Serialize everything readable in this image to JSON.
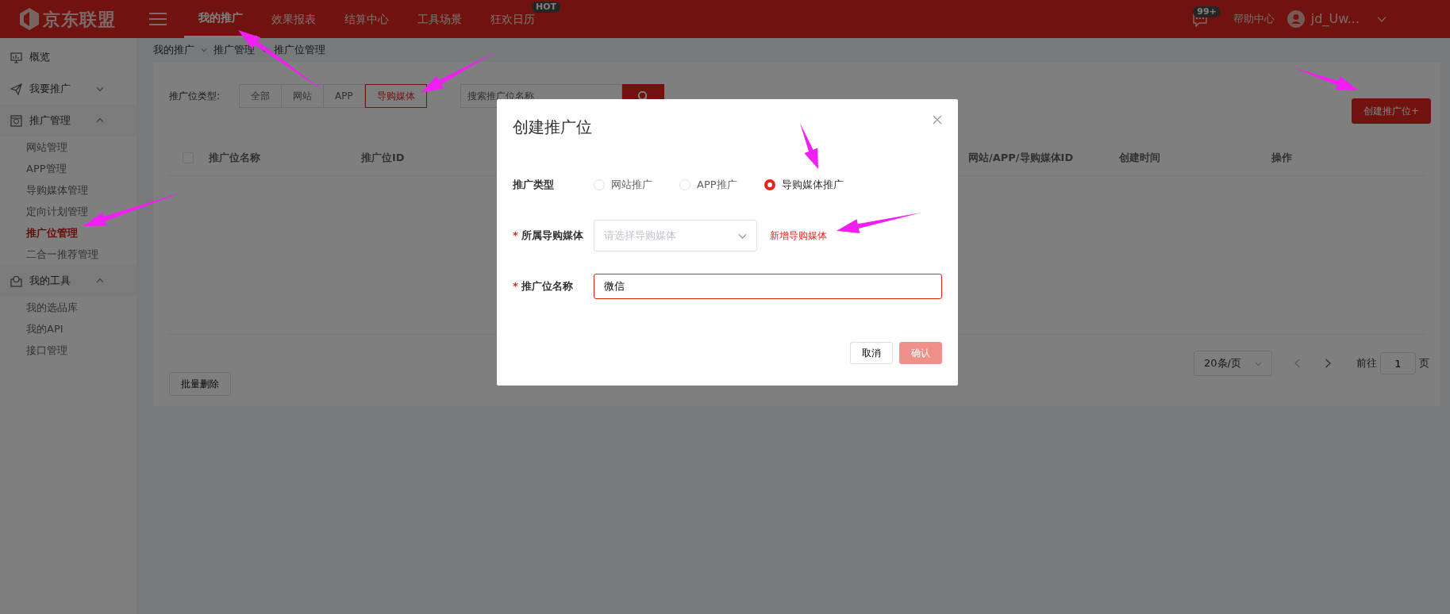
{
  "header": {
    "logo": "京东联盟",
    "nav": [
      {
        "label": "我的推广",
        "selected": true
      },
      {
        "label": "效果报表",
        "selected": false
      },
      {
        "label": "结算中心",
        "selected": false
      },
      {
        "label": "工具场景",
        "selected": false
      },
      {
        "label": "狂欢日历",
        "selected": false,
        "badge": "HOT"
      }
    ],
    "message_badge": "99+",
    "help": "帮助中心",
    "user": "jd_Uw..."
  },
  "sidebar": {
    "items": [
      {
        "label": "概览"
      },
      {
        "label": "我要推广",
        "expanded": false
      },
      {
        "label": "推广管理",
        "expanded": true,
        "children": [
          {
            "label": "网站管理",
            "selected": false
          },
          {
            "label": "APP管理",
            "selected": false
          },
          {
            "label": "导购媒体管理",
            "selected": false
          },
          {
            "label": "定向计划管理",
            "selected": false
          },
          {
            "label": "推广位管理",
            "selected": true
          },
          {
            "label": "二合一推荐管理",
            "selected": false
          }
        ]
      },
      {
        "label": "我的工具",
        "expanded": true,
        "children": [
          {
            "label": "我的选品库",
            "selected": false
          },
          {
            "label": "我的API",
            "selected": false
          },
          {
            "label": "接口管理",
            "selected": false
          }
        ]
      }
    ]
  },
  "breadcrumb": [
    "我的推广",
    "推广管理",
    "推广位管理"
  ],
  "filter": {
    "label": "推广位类型:",
    "options": [
      {
        "label": "全部",
        "selected": false
      },
      {
        "label": "网站",
        "selected": false
      },
      {
        "label": "APP",
        "selected": false
      },
      {
        "label": "导购媒体",
        "selected": true
      }
    ],
    "search": {
      "placeholder": "搜索推广位名称"
    }
  },
  "create_button": "创建推广位+",
  "table": {
    "select_all_checked": false,
    "columns": [
      "推广位名称",
      "推广位ID",
      "网站/APP/导购媒体ID",
      "创建时间",
      "操作"
    ]
  },
  "pagination": {
    "page_size": "20条/页",
    "goto_label": "前往",
    "page": "1",
    "page_suffix": "页"
  },
  "bulk_delete": "批量删除",
  "dialog": {
    "title": "创建推广位",
    "fields": [
      {
        "kind": "radio",
        "label": "推广类型",
        "options": [
          {
            "label": "网站推广",
            "selected": false
          },
          {
            "label": "APP推广",
            "selected": false
          },
          {
            "label": "导购媒体推广",
            "selected": true
          }
        ]
      },
      {
        "kind": "select",
        "label": "所属导购媒体",
        "required_mark": "*",
        "placeholder": "请选择导购媒体",
        "link": "新增导购媒体"
      },
      {
        "kind": "input",
        "label": "推广位名称",
        "required_mark": "*",
        "value": "微信",
        "error": true
      }
    ],
    "buttons": [
      {
        "label": "取消",
        "kind": "default",
        "disabled": false
      },
      {
        "label": "确认",
        "kind": "primary",
        "disabled": true
      }
    ]
  }
}
